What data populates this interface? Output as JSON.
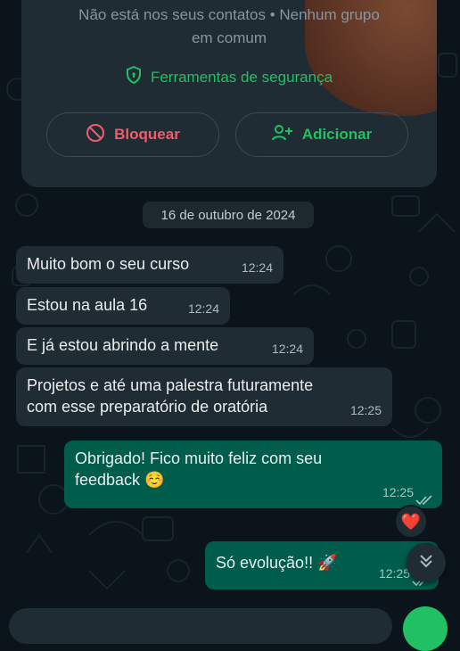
{
  "contact_card": {
    "info_line1": "Não está nos seus contatos • Nenhum grupo",
    "info_line2": "em comum",
    "security_label": "Ferramentas de segurança",
    "block_label": "Bloquear",
    "add_label": "Adicionar"
  },
  "date_chip": "16 de outubro de 2024",
  "messages": [
    {
      "direction": "in",
      "text": "Muito bom o seu curso",
      "time": "12:24"
    },
    {
      "direction": "in",
      "text": "Estou na aula 16",
      "time": "12:24"
    },
    {
      "direction": "in",
      "text": "E já estou abrindo a mente",
      "time": "12:24"
    },
    {
      "direction": "in",
      "text_line1": "Projetos e até uma palestra futuramente",
      "text_line2": "com esse preparatório de oratória",
      "time": "12:25"
    },
    {
      "direction": "out",
      "text_line1": "Obrigado! Fico muito feliz com seu",
      "text_line2": "feedback ☺️",
      "time": "12:25",
      "status": "read"
    },
    {
      "direction": "out",
      "text": "Só evolução!! 🚀",
      "time": "12:25",
      "status": "read"
    }
  ],
  "reaction": "❤️",
  "colors": {
    "background": "#0b141a",
    "incoming_bubble": "#202c33",
    "outgoing_bubble": "#005c4b",
    "accent_green": "#21c063",
    "danger_red": "#f15c6d"
  },
  "icons": {
    "security": "shield-icon",
    "block": "block-icon",
    "add": "add-person-icon",
    "scroll": "chevron-double-down-icon",
    "read_status": "double-check-icon"
  }
}
